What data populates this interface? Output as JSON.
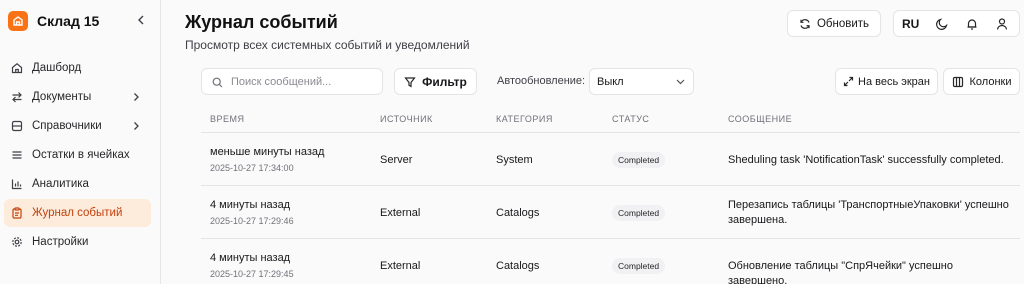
{
  "app": {
    "brand_title": "Склад 15",
    "accent_color": "#f97316",
    "active_bg": "#fdecdc"
  },
  "sidebar": {
    "items": [
      {
        "label": "Дашборд",
        "icon": "home-icon",
        "has_chevron": false,
        "active": false
      },
      {
        "label": "Документы",
        "icon": "arrows-icon",
        "has_chevron": true,
        "active": false
      },
      {
        "label": "Справочники",
        "icon": "book-icon",
        "has_chevron": true,
        "active": false
      },
      {
        "label": "Остатки в ячейках",
        "icon": "list-icon",
        "has_chevron": false,
        "active": false
      },
      {
        "label": "Аналитика",
        "icon": "chart-icon",
        "has_chevron": false,
        "active": false
      },
      {
        "label": "Журнал событий",
        "icon": "clipboard-icon",
        "has_chevron": false,
        "active": true
      },
      {
        "label": "Настройки",
        "icon": "gear-icon",
        "has_chevron": false,
        "active": false
      }
    ]
  },
  "header": {
    "title": "Журнал событий",
    "subtitle": "Просмотр всех системных событий и уведомлений",
    "refresh_label": "Обновить",
    "language": "RU"
  },
  "toolbar": {
    "search_placeholder": "Поиск сообщений...",
    "filter_label": "Фильтр",
    "autorefresh_label": "Автообновление:",
    "autorefresh_value": "Выкл",
    "fullscreen_label": "На весь экран",
    "columns_label": "Колонки"
  },
  "table": {
    "columns": [
      "ВРЕМЯ",
      "ИСТОЧНИК",
      "КАТЕГОРИЯ",
      "СТАТУС",
      "СООБЩЕНИЕ"
    ],
    "rows": [
      {
        "time_relative": "меньше минуты назад",
        "time_exact": "2025-10-27 17:34:00",
        "source": "Server",
        "category": "System",
        "status": "Completed",
        "message": "Sheduling task 'NotificationTask' successfully completed."
      },
      {
        "time_relative": "4 минуты назад",
        "time_exact": "2025-10-27 17:29:46",
        "source": "External",
        "category": "Catalogs",
        "status": "Completed",
        "message": "Перезапись таблицы 'ТранспортныеУпаковки' успешно завершена."
      },
      {
        "time_relative": "4 минуты назад",
        "time_exact": "2025-10-27 17:29:45",
        "source": "External",
        "category": "Catalogs",
        "status": "Completed",
        "message": "Обновление таблицы \"СпрЯчейки\" успешно завершено."
      }
    ]
  }
}
